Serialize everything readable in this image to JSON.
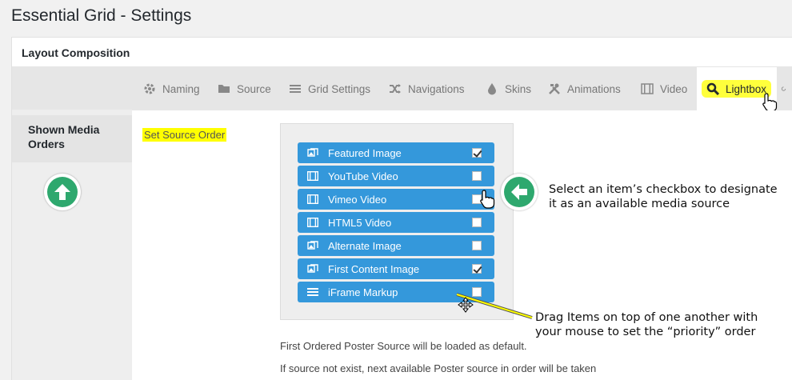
{
  "page": {
    "title": "Essential Grid - Settings"
  },
  "panel": {
    "header_title": "Layout Composition"
  },
  "sidebar": {
    "active_item": "Shown Media Orders"
  },
  "tabs": [
    {
      "label": "Naming",
      "icon": "gear-icon"
    },
    {
      "label": "Source",
      "icon": "folder-icon"
    },
    {
      "label": "Grid Settings",
      "icon": "menu-lines-icon"
    },
    {
      "label": "Navigations",
      "icon": "shuffle-icon"
    },
    {
      "label": "Skins",
      "icon": "droplet-icon"
    },
    {
      "label": "Animations",
      "icon": "tools-icon"
    },
    {
      "label": "Video",
      "icon": "film-icon"
    },
    {
      "label": "Lightbox",
      "icon": "search-icon",
      "active": true
    }
  ],
  "content": {
    "set_order_label": "Set Source Order",
    "items": [
      {
        "label": "Featured Image",
        "icon": "image-icon",
        "checked": true
      },
      {
        "label": "YouTube Video",
        "icon": "film-icon",
        "checked": false
      },
      {
        "label": "Vimeo Video",
        "icon": "film-icon",
        "checked": false
      },
      {
        "label": "HTML5 Video",
        "icon": "film-icon",
        "checked": false
      },
      {
        "label": "Alternate Image",
        "icon": "image-icon",
        "checked": false
      },
      {
        "label": "First Content Image",
        "icon": "image-icon",
        "checked": true
      },
      {
        "label": "iFrame Markup",
        "icon": "menu-lines-icon",
        "checked": false
      }
    ],
    "note_1": "First Ordered Poster Source will be loaded as default.",
    "note_2": "If source not exist, next available Poster source in order will be taken"
  },
  "annotations": {
    "checkbox_callout_line1": "Select an item’s checkbox to designate",
    "checkbox_callout_line2": "it as an available media source",
    "drag_callout_line1": "Drag Items on top of one another with",
    "drag_callout_line2": "your mouse to set the “priority” order"
  },
  "colors": {
    "item_blue": "#3498db",
    "highlight_yellow": "#ffff00",
    "callout_green": "#2ea86e"
  }
}
